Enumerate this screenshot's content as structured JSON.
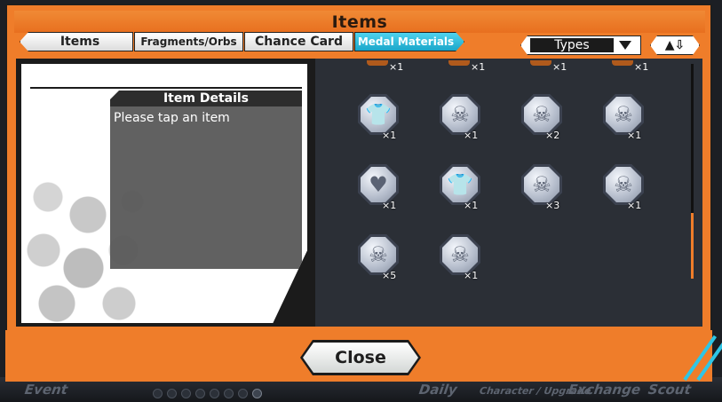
{
  "window": {
    "title": "Items"
  },
  "tabs": [
    {
      "label": "Items"
    },
    {
      "label": "Fragments/Orbs"
    },
    {
      "label": "Chance Card"
    },
    {
      "label": "Medal Materials",
      "active": true
    }
  ],
  "filter": {
    "label": "Types",
    "sort_icon": "sort-up-down-icon"
  },
  "details": {
    "header": "Item Details",
    "placeholder": "Please tap an item"
  },
  "partial_row": [
    {
      "count": "×1"
    },
    {
      "count": "×1"
    },
    {
      "count": "×1"
    },
    {
      "count": "×1"
    }
  ],
  "items": [
    {
      "icon": "shirt-icon",
      "count": "×1"
    },
    {
      "icon": "skull-icon",
      "count": "×1"
    },
    {
      "icon": "skull-icon",
      "count": "×2"
    },
    {
      "icon": "skull-icon",
      "count": "×1"
    },
    {
      "icon": "heart-icon",
      "count": "×1"
    },
    {
      "icon": "shirt-icon",
      "count": "×1"
    },
    {
      "icon": "skull-icon",
      "count": "×3"
    },
    {
      "icon": "skull-icon",
      "count": "×1"
    },
    {
      "icon": "skull-icon",
      "count": "×5"
    },
    {
      "icon": "skull-icon",
      "count": "×1"
    }
  ],
  "footer": {
    "close_label": "Close"
  },
  "background_nav": {
    "labels": [
      "Event",
      "Daily",
      "Character / Upgrade",
      "Exchange",
      "Scout"
    ]
  },
  "colors": {
    "frame": "#ef7d2a",
    "active_tab": "#1aa6c9",
    "panel": "#2b2f36"
  }
}
